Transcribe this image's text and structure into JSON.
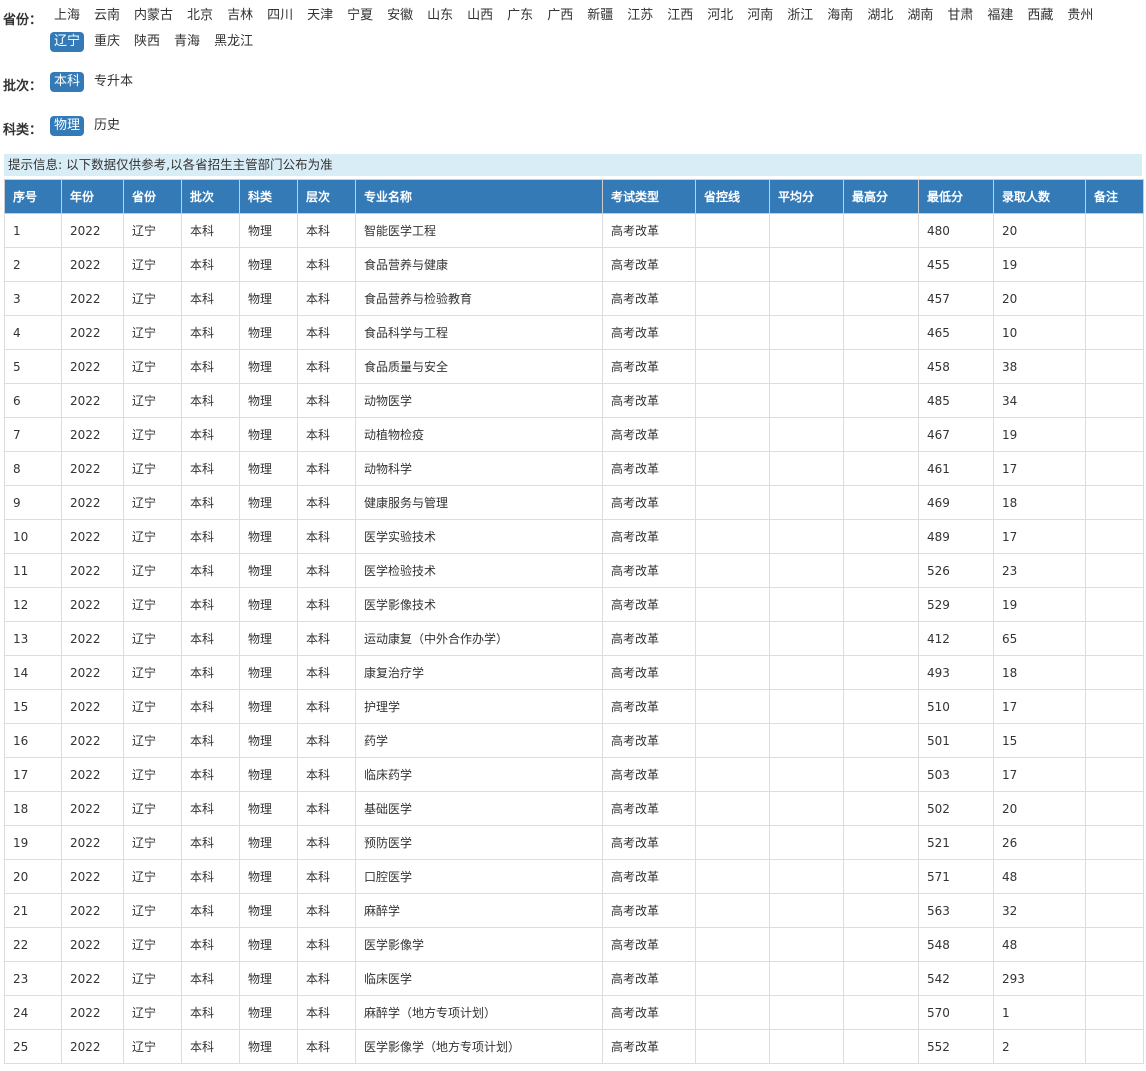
{
  "filters": {
    "province": {
      "label": "省份：",
      "options": [
        "上海",
        "云南",
        "内蒙古",
        "北京",
        "吉林",
        "四川",
        "天津",
        "宁夏",
        "安徽",
        "山东",
        "山西",
        "广东",
        "广西",
        "新疆",
        "江苏",
        "江西",
        "河北",
        "河南",
        "浙江",
        "海南",
        "湖北",
        "湖南",
        "甘肃",
        "福建",
        "西藏",
        "贵州",
        "辽宁",
        "重庆",
        "陕西",
        "青海",
        "黑龙江"
      ],
      "selected": "辽宁"
    },
    "batch": {
      "label": "批次：",
      "options": [
        "本科",
        "专升本"
      ],
      "selected": "本科"
    },
    "subject": {
      "label": "科类：",
      "options": [
        "物理",
        "历史"
      ],
      "selected": "物理"
    }
  },
  "hint": "提示信息: 以下数据仅供参考,以各省招生主管部门公布为准",
  "table": {
    "headers": [
      "序号",
      "年份",
      "省份",
      "批次",
      "科类",
      "层次",
      "专业名称",
      "考试类型",
      "省控线",
      "平均分",
      "最高分",
      "最低分",
      "录取人数",
      "备注"
    ],
    "rows": [
      [
        "1",
        "2022",
        "辽宁",
        "本科",
        "物理",
        "本科",
        "智能医学工程",
        "高考改革",
        "",
        "",
        "",
        "480",
        "20",
        ""
      ],
      [
        "2",
        "2022",
        "辽宁",
        "本科",
        "物理",
        "本科",
        "食品营养与健康",
        "高考改革",
        "",
        "",
        "",
        "455",
        "19",
        ""
      ],
      [
        "3",
        "2022",
        "辽宁",
        "本科",
        "物理",
        "本科",
        "食品营养与检验教育",
        "高考改革",
        "",
        "",
        "",
        "457",
        "20",
        ""
      ],
      [
        "4",
        "2022",
        "辽宁",
        "本科",
        "物理",
        "本科",
        "食品科学与工程",
        "高考改革",
        "",
        "",
        "",
        "465",
        "10",
        ""
      ],
      [
        "5",
        "2022",
        "辽宁",
        "本科",
        "物理",
        "本科",
        "食品质量与安全",
        "高考改革",
        "",
        "",
        "",
        "458",
        "38",
        ""
      ],
      [
        "6",
        "2022",
        "辽宁",
        "本科",
        "物理",
        "本科",
        "动物医学",
        "高考改革",
        "",
        "",
        "",
        "485",
        "34",
        ""
      ],
      [
        "7",
        "2022",
        "辽宁",
        "本科",
        "物理",
        "本科",
        "动植物检疫",
        "高考改革",
        "",
        "",
        "",
        "467",
        "19",
        ""
      ],
      [
        "8",
        "2022",
        "辽宁",
        "本科",
        "物理",
        "本科",
        "动物科学",
        "高考改革",
        "",
        "",
        "",
        "461",
        "17",
        ""
      ],
      [
        "9",
        "2022",
        "辽宁",
        "本科",
        "物理",
        "本科",
        "健康服务与管理",
        "高考改革",
        "",
        "",
        "",
        "469",
        "18",
        ""
      ],
      [
        "10",
        "2022",
        "辽宁",
        "本科",
        "物理",
        "本科",
        "医学实验技术",
        "高考改革",
        "",
        "",
        "",
        "489",
        "17",
        ""
      ],
      [
        "11",
        "2022",
        "辽宁",
        "本科",
        "物理",
        "本科",
        "医学检验技术",
        "高考改革",
        "",
        "",
        "",
        "526",
        "23",
        ""
      ],
      [
        "12",
        "2022",
        "辽宁",
        "本科",
        "物理",
        "本科",
        "医学影像技术",
        "高考改革",
        "",
        "",
        "",
        "529",
        "19",
        ""
      ],
      [
        "13",
        "2022",
        "辽宁",
        "本科",
        "物理",
        "本科",
        "运动康复（中外合作办学）",
        "高考改革",
        "",
        "",
        "",
        "412",
        "65",
        ""
      ],
      [
        "14",
        "2022",
        "辽宁",
        "本科",
        "物理",
        "本科",
        "康复治疗学",
        "高考改革",
        "",
        "",
        "",
        "493",
        "18",
        ""
      ],
      [
        "15",
        "2022",
        "辽宁",
        "本科",
        "物理",
        "本科",
        "护理学",
        "高考改革",
        "",
        "",
        "",
        "510",
        "17",
        ""
      ],
      [
        "16",
        "2022",
        "辽宁",
        "本科",
        "物理",
        "本科",
        "药学",
        "高考改革",
        "",
        "",
        "",
        "501",
        "15",
        ""
      ],
      [
        "17",
        "2022",
        "辽宁",
        "本科",
        "物理",
        "本科",
        "临床药学",
        "高考改革",
        "",
        "",
        "",
        "503",
        "17",
        ""
      ],
      [
        "18",
        "2022",
        "辽宁",
        "本科",
        "物理",
        "本科",
        "基础医学",
        "高考改革",
        "",
        "",
        "",
        "502",
        "20",
        ""
      ],
      [
        "19",
        "2022",
        "辽宁",
        "本科",
        "物理",
        "本科",
        "预防医学",
        "高考改革",
        "",
        "",
        "",
        "521",
        "26",
        ""
      ],
      [
        "20",
        "2022",
        "辽宁",
        "本科",
        "物理",
        "本科",
        "口腔医学",
        "高考改革",
        "",
        "",
        "",
        "571",
        "48",
        ""
      ],
      [
        "21",
        "2022",
        "辽宁",
        "本科",
        "物理",
        "本科",
        "麻醉学",
        "高考改革",
        "",
        "",
        "",
        "563",
        "32",
        ""
      ],
      [
        "22",
        "2022",
        "辽宁",
        "本科",
        "物理",
        "本科",
        "医学影像学",
        "高考改革",
        "",
        "",
        "",
        "548",
        "48",
        ""
      ],
      [
        "23",
        "2022",
        "辽宁",
        "本科",
        "物理",
        "本科",
        "临床医学",
        "高考改革",
        "",
        "",
        "",
        "542",
        "293",
        ""
      ],
      [
        "24",
        "2022",
        "辽宁",
        "本科",
        "物理",
        "本科",
        "麻醉学（地方专项计划）",
        "高考改革",
        "",
        "",
        "",
        "570",
        "1",
        ""
      ],
      [
        "25",
        "2022",
        "辽宁",
        "本科",
        "物理",
        "本科",
        "医学影像学（地方专项计划）",
        "高考改革",
        "",
        "",
        "",
        "552",
        "2",
        ""
      ]
    ]
  },
  "colors": {
    "accent": "#337ab7",
    "hint_bg": "#d9edf7"
  }
}
